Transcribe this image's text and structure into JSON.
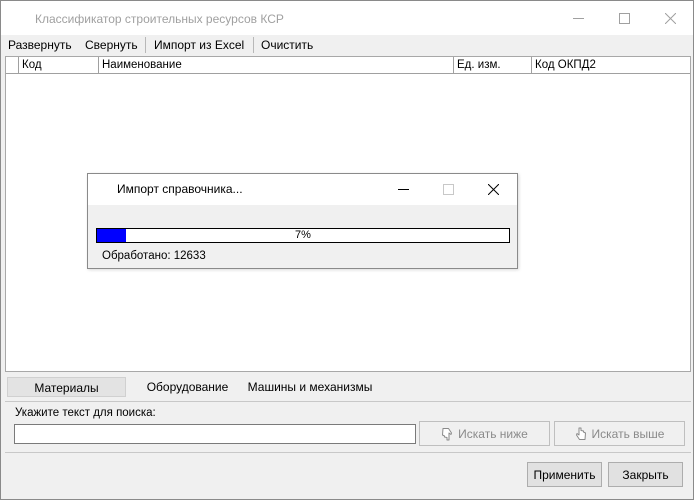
{
  "window": {
    "title": "Классификатор строительных ресурсов КСР"
  },
  "menu": {
    "expand": "Развернуть",
    "collapse": "Свернуть",
    "import_excel": "Импорт из Excel",
    "clear": "Очистить"
  },
  "grid": {
    "columns": [
      "Код",
      "Наименование",
      "Ед. изм.",
      "Код ОКПД2"
    ]
  },
  "dialog": {
    "title": "Импорт справочника...",
    "progress_percent": 7,
    "progress_text": "7%",
    "processed_label": "Обработано:",
    "processed_value": "12633"
  },
  "tabs": [
    "Материалы",
    "Оборудование",
    "Машины и механизмы"
  ],
  "search": {
    "label": "Укажите текст для поиска:",
    "value": "",
    "search_down": "Искать ниже",
    "search_up": "Искать выше"
  },
  "footer": {
    "apply": "Применить",
    "close": "Закрыть"
  }
}
